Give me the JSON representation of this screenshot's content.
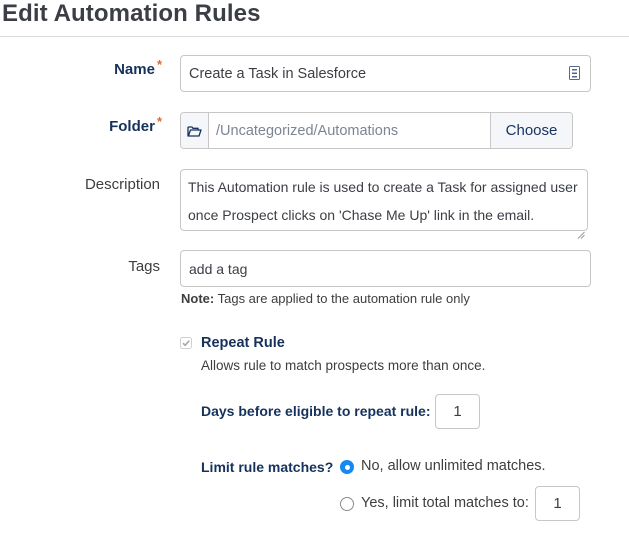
{
  "page": {
    "title": "Edit Automation Rules"
  },
  "form": {
    "name": {
      "label": "Name",
      "required_mark": "*",
      "value": "Create a Task in Salesforce"
    },
    "folder": {
      "label": "Folder",
      "required_mark": "*",
      "path": "/Uncategorized/Automations",
      "choose_label": "Choose"
    },
    "description": {
      "label": "Description",
      "line1": "This Automation rule is used to create a Task for assigned user",
      "line2": "once Prospect clicks on 'Chase Me Up' link in the email."
    },
    "tags": {
      "label": "Tags",
      "value": "add a tag",
      "note_prefix": "Note:",
      "note_text": "Tags are applied to the automation rule only"
    },
    "repeat": {
      "checked": true,
      "label": "Repeat Rule",
      "help": "Allows rule to match prospects more than once.",
      "days_label": "Days before eligible to repeat rule:",
      "days_value": "1"
    },
    "limit": {
      "label": "Limit rule matches?",
      "selected": "unlimited",
      "option_unlimited": "No, allow unlimited matches.",
      "option_limit": "Yes, limit total matches to:",
      "limit_value": "1"
    }
  },
  "colors": {
    "accent": "#1589ee",
    "required": "#e56a26",
    "label": "#16325c",
    "border": "#c9c7c5"
  },
  "icons": [
    "document-icon",
    "folder-icon",
    "resize-grip-icon",
    "checkmark-icon"
  ]
}
